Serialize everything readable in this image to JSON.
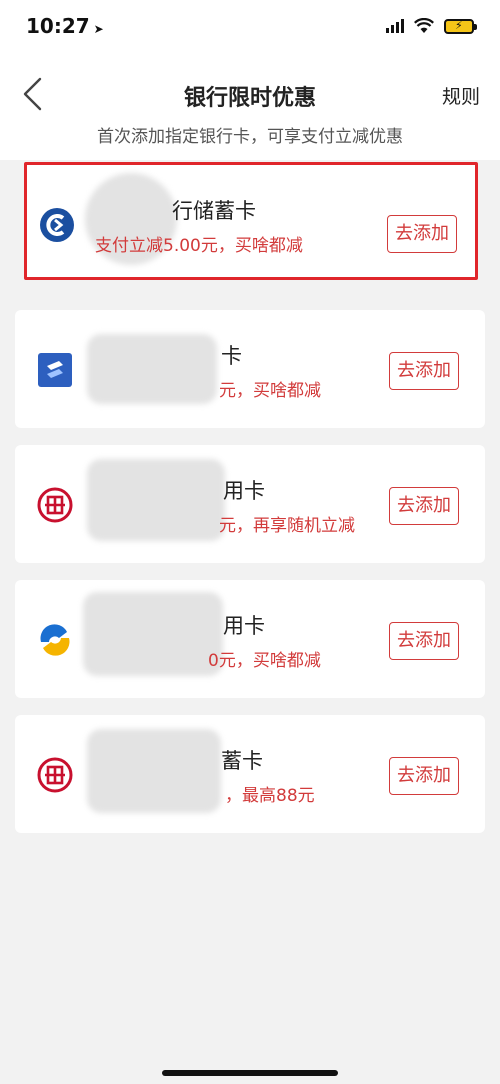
{
  "status_bar": {
    "time": "10:27",
    "location_arrow": "➤"
  },
  "nav": {
    "title": "银行限时优惠",
    "rules_label": "规则",
    "back_icon": "chevron-left-icon"
  },
  "subtitle": "首次添加指定银行卡，可享支付立减优惠",
  "cards": [
    {
      "title": "行储蓄卡",
      "desc": "支付立减5.00元，买啥都减",
      "button": "去添加",
      "logo": "bank-logo-blue-c",
      "highlighted": true
    },
    {
      "title": "卡",
      "desc": "元，买啥都减",
      "button": "去添加",
      "logo": "bank-logo-blue-square"
    },
    {
      "title": "用卡",
      "desc": "元，再享随机立减",
      "button": "去添加",
      "logo": "bank-logo-red-seal"
    },
    {
      "title": "用卡",
      "desc": "0元，买啥都减",
      "button": "去添加",
      "logo": "bank-logo-blue-yellow"
    },
    {
      "title": "蓄卡",
      "desc": "，最高88元",
      "button": "去添加",
      "logo": "bank-logo-red-seal"
    }
  ],
  "colors": {
    "accent": "#d23b3b",
    "highlight_border": "#e0262b",
    "background": "#f2f2f2"
  }
}
